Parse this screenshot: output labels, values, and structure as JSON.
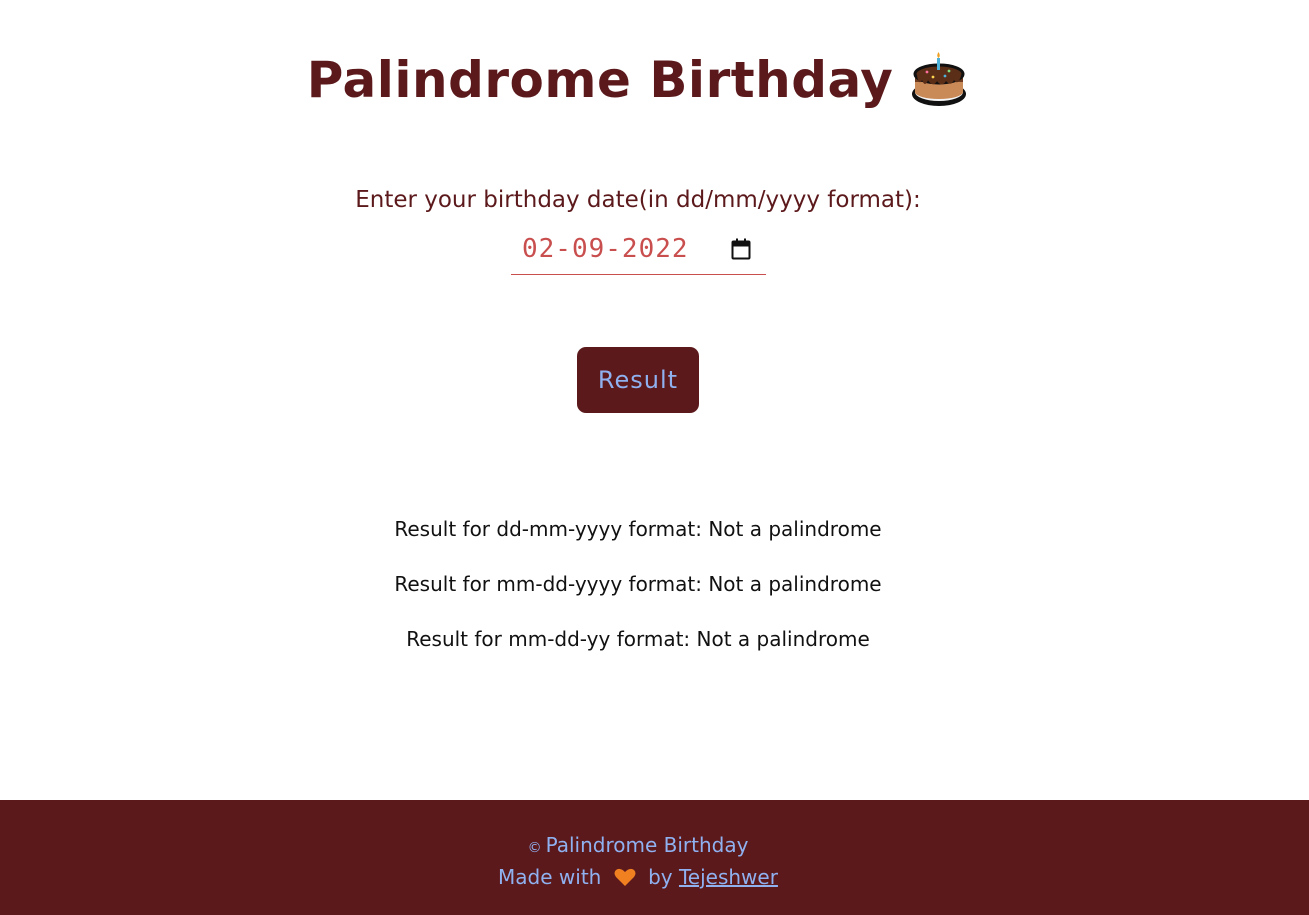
{
  "header": {
    "title": "Palindrome Birthday",
    "icon": "birthday-cake-icon"
  },
  "form": {
    "label": "Enter your birthday date(in dd/mm/yyyy format):",
    "date_value": "02-09-2022",
    "calendar_icon": "calendar-icon",
    "submit_label": "Result"
  },
  "results": [
    "Result for dd-mm-yyyy format: Not a palindrome",
    "Result for mm-dd-yyyy format: Not a palindrome",
    "Result for mm-dd-yy format: Not a palindrome"
  ],
  "footer": {
    "copyright_symbol": "©",
    "copyright_text": "Palindrome Birthday",
    "made_with": "Made with",
    "heart_icon": "heart-icon",
    "by": "by",
    "author": "Tejeshwer"
  },
  "colors": {
    "primary": "#5c191c",
    "accent_text": "#8fb1f0",
    "date_text": "#c94e4e",
    "background": "#ffffff"
  }
}
